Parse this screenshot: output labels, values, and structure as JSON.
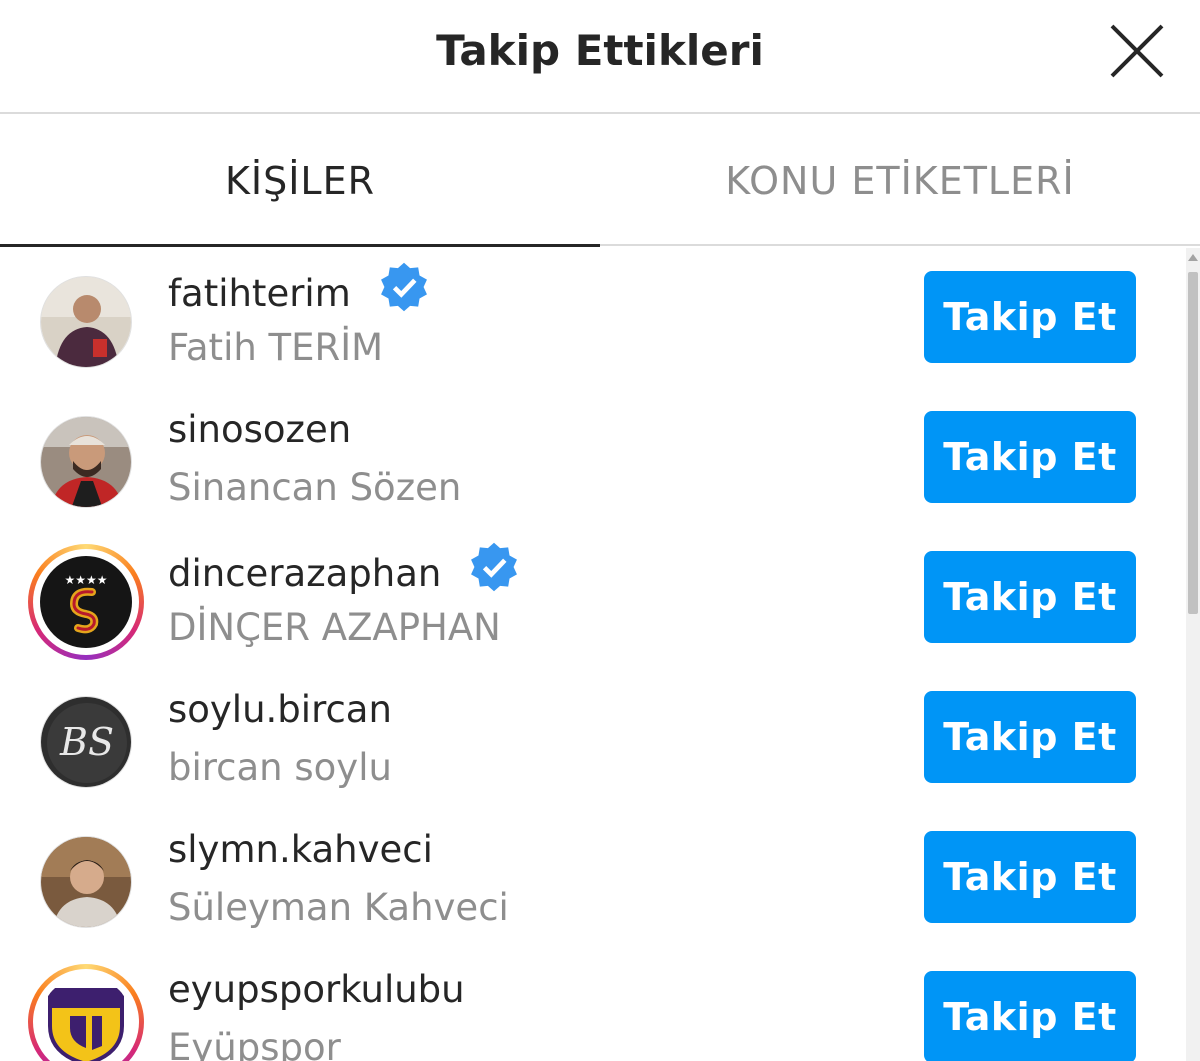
{
  "header": {
    "title": "Takip Ettikleri",
    "close_icon": "close-icon"
  },
  "tabs": [
    {
      "label": "KİŞİLER",
      "active": true
    },
    {
      "label": "KONU ETİKETLERİ",
      "active": false
    }
  ],
  "colors": {
    "accent": "#0095f6",
    "verified": "#3897f0",
    "text_primary": "#262626",
    "text_secondary": "#8e8e8e",
    "divider": "#dbdbdb"
  },
  "users": [
    {
      "username": "fatihterim",
      "full_name": "Fatih TERİM",
      "verified": true,
      "story_ring": false,
      "button": "Takip Et"
    },
    {
      "username": "sinosozen",
      "full_name": "Sinancan Sözen",
      "verified": false,
      "story_ring": false,
      "button": "Takip Et"
    },
    {
      "username": "dincerazaphan",
      "full_name": "DİNÇER AZAPHAN",
      "verified": true,
      "story_ring": true,
      "button": "Takip Et"
    },
    {
      "username": "soylu.bircan",
      "full_name": "bircan soylu",
      "verified": false,
      "story_ring": false,
      "button": "Takip Et"
    },
    {
      "username": "slymn.kahveci",
      "full_name": "Süleyman Kahveci",
      "verified": false,
      "story_ring": false,
      "button": "Takip Et"
    },
    {
      "username": "eyupsporkulubu",
      "full_name": "Eyüpspor",
      "verified": false,
      "story_ring": true,
      "button": "Takip Et"
    }
  ]
}
